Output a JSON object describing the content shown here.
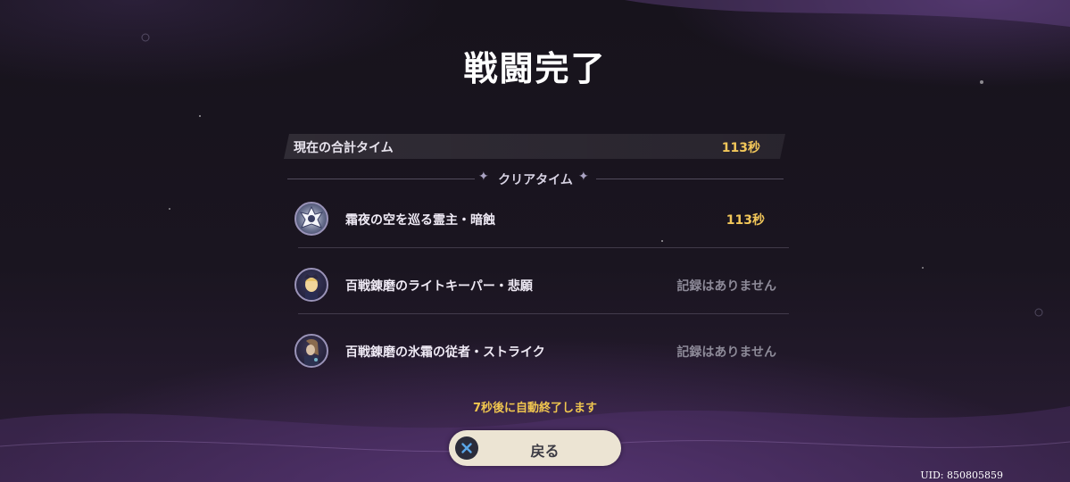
{
  "title": "戦闘完了",
  "total": {
    "label": "現在の合計タイム",
    "value": "113秒"
  },
  "section": {
    "label": "クリアタイム"
  },
  "entries": [
    {
      "name": "霜夜の空を巡る霊主・暗蝕",
      "time": "113秒",
      "icon": "boss-emblem-icon"
    },
    {
      "name": "百戦錬磨のライトキーパー・悲願",
      "time": "記録はありません",
      "icon": "lightkeeper-portrait-icon"
    },
    {
      "name": "百戦錬磨の氷霜の従者・ストライク",
      "time": "記録はありません",
      "icon": "frost-servant-portrait-icon"
    }
  ],
  "auto_exit": "7秒後に自動終了します",
  "back_button": {
    "label": "戻る",
    "icon": "cross-button-icon"
  },
  "uid": "UID: 850805859",
  "colors": {
    "accent_gold": "#f2c75a",
    "muted_text": "#8d8a98",
    "button_bg": "#ece4d3"
  }
}
